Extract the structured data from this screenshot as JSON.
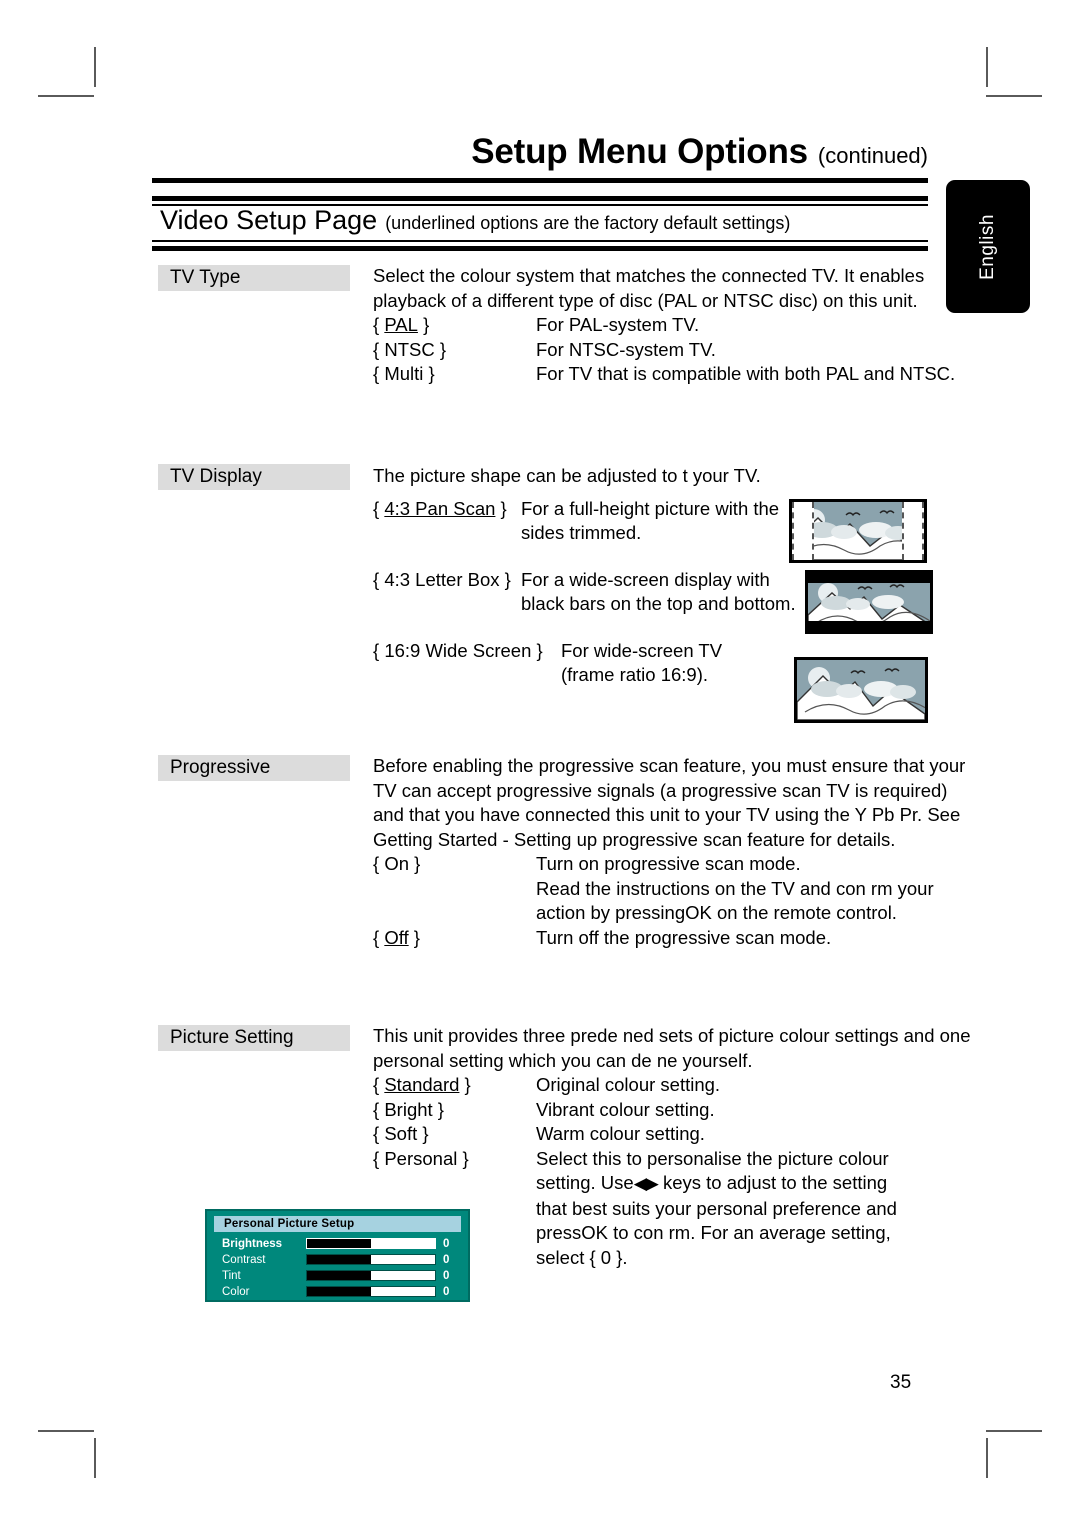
{
  "header": {
    "title": "Setup Menu Options",
    "continued": "(continued)",
    "band_title": "Video Setup Page",
    "band_note": "(underlined options are the factory default settings)"
  },
  "language_tab": {
    "label": "English"
  },
  "page_number": "35",
  "sections": [
    {
      "label": "TV Type",
      "intro": "Select the colour system that matches the connected TV. It enables playback of a different type of disc (PAL or NTSC disc) on this unit.",
      "options": [
        {
          "key": "{ PAL }",
          "key_text": "PAL",
          "underlined": true,
          "desc": "For PAL-system TV."
        },
        {
          "key": "{ NTSC }",
          "key_text": "NTSC",
          "underlined": false,
          "desc": "For NTSC-system TV."
        },
        {
          "key": "{ Multi }",
          "key_text": "Multi",
          "underlined": false,
          "desc": "For TV that is compatible with both PAL and NTSC."
        }
      ]
    },
    {
      "label": "TV Display",
      "intro": "The picture shape can be adjusted to  t your TV.",
      "options": [
        {
          "key": "{ 4:3 Pan Scan }",
          "key_text": "4:3 Pan Scan",
          "underlined": true,
          "desc": "For a full-height picture with the sides trimmed."
        },
        {
          "key": "{ 4:3 Letter Box }",
          "key_text": "4:3 Letter Box",
          "underlined": false,
          "desc": "For a  wide-screen  display with black bars on the top and bottom."
        },
        {
          "key": "{ 16:9 Wide Screen }",
          "key_text": "16:9 Wide Screen",
          "underlined": false,
          "desc": "For wide-screen TV (frame ratio 16:9)."
        }
      ]
    },
    {
      "label": "Progressive",
      "intro": "Before enabling the progressive scan feature, you must ensure that your TV can accept progressive signals (a progressive scan TV is required) and that you have connected this unit to your TV using the Y Pb Pr. See  Getting Started - Setting up progressive scan feature  for details.",
      "options": [
        {
          "key": "{ On }",
          "key_text": "On",
          "underlined": false,
          "desc": "Turn on progressive scan mode."
        },
        {
          "key": "{ Off }",
          "key_text": "Off",
          "underlined": true,
          "desc": "Turn off the progressive scan mode."
        }
      ],
      "on_extra": "Read the instructions on the TV and con rm your action by pressingOK  on the remote control."
    },
    {
      "label": "Picture Setting",
      "intro": "This unit provides three prede ned sets of picture colour settings and one personal setting which you can de ne yourself.",
      "options": [
        {
          "key": "{ Standard }",
          "key_text": "Standard",
          "underlined": true,
          "desc": "Original colour setting."
        },
        {
          "key": "{ Bright }",
          "key_text": "Bright",
          "underlined": false,
          "desc": "Vibrant colour setting."
        },
        {
          "key": "{ Soft }",
          "key_text": "Soft",
          "underlined": false,
          "desc": "Warm colour setting."
        },
        {
          "key": "{ Personal }",
          "key_text": "Personal",
          "underlined": false,
          "desc": "Select this to personalise the picture colour"
        }
      ],
      "personal_lines": {
        "line1_pre": "setting. Use",
        "line1_post": " keys to adjust to the setting",
        "line2": "that best suits your personal preference and",
        "line3": "pressOK  to con rm. For an average setting,",
        "line4": "select { 0 }."
      }
    }
  ],
  "tv_thumbnails": [
    {
      "name": "pan-scan",
      "kind": "pan-scan"
    },
    {
      "name": "letter-box",
      "kind": "letter-box"
    },
    {
      "name": "wide-screen",
      "kind": "wide-screen"
    }
  ],
  "osd": {
    "title": "Personal Picture Setup",
    "rows": [
      {
        "name": "Brightness",
        "value": "0",
        "fill_percent": 50,
        "selected": true
      },
      {
        "name": "Contrast",
        "value": "0",
        "fill_percent": 50,
        "selected": false
      },
      {
        "name": "Tint",
        "value": "0",
        "fill_percent": 50,
        "selected": false
      },
      {
        "name": "Color",
        "value": "0",
        "fill_percent": 50,
        "selected": false
      }
    ]
  },
  "colors": {
    "osd_background": "#00887c",
    "osd_title_bar": "#a6d2e0",
    "label_chip": "#dcdcdc",
    "tab_background": "#000000",
    "sky": "#8ba3ad"
  }
}
